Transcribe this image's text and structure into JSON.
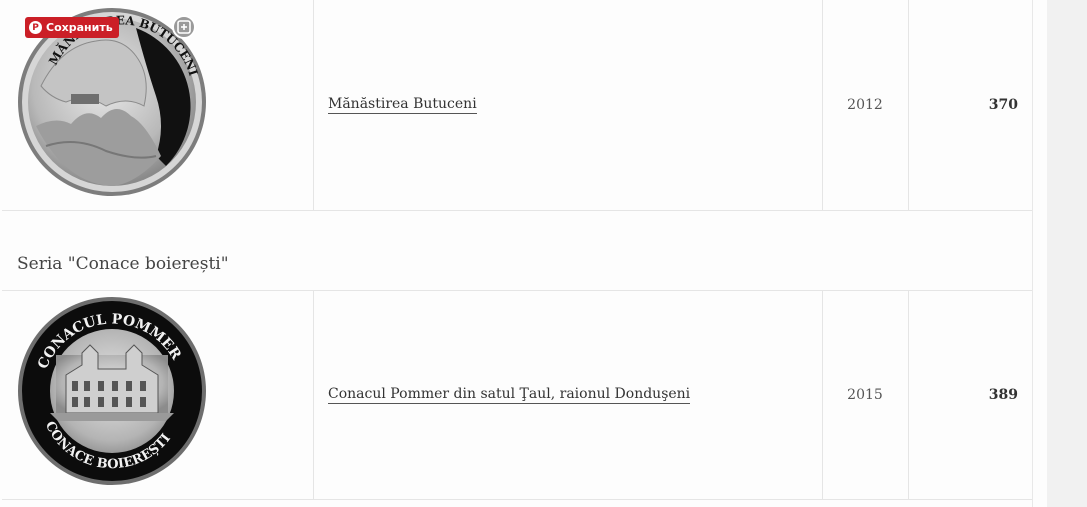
{
  "pinterest": {
    "save_label": "Сохранить"
  },
  "rows": [
    {
      "coin_inscription": "MĂNĂSTIREA BUTUCENI",
      "name": "Mănăstirea Butuceni",
      "year": "2012",
      "number": "370"
    },
    {
      "coin_inscription_top": "CONACUL POMMER",
      "coin_inscription_bottom": "CONACE BOIEREȘTI",
      "name": "Conacul Pommer din satul Ţaul, raionul Donduşeni",
      "year": "2015",
      "number": "389"
    }
  ],
  "series": {
    "title": "Seria \"Conace boierești\""
  },
  "colors": {
    "pinterest_red": "#cb1f27",
    "border": "#e5e5e5",
    "link_underline": "#555555"
  }
}
